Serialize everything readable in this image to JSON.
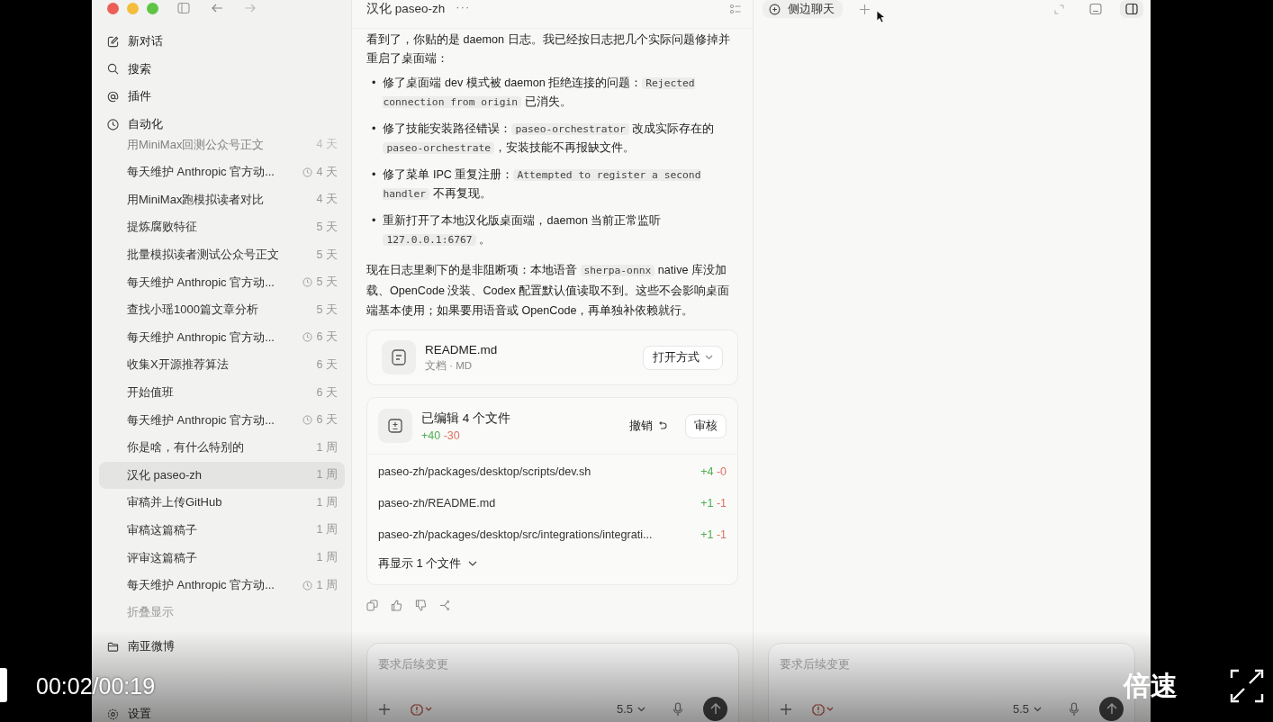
{
  "sidebar": {
    "nav": [
      {
        "label": "新对话"
      },
      {
        "label": "搜索"
      },
      {
        "label": "插件"
      },
      {
        "label": "自动化"
      }
    ],
    "conversations": [
      {
        "title": "用MiniMax回测公众号正文",
        "time": "4 天",
        "scheduled": false,
        "selected": false,
        "faded": true
      },
      {
        "title": "每天维护 Anthropic 官方动...",
        "time": "4 天",
        "scheduled": true,
        "selected": false,
        "faded": false
      },
      {
        "title": "用MiniMax跑模拟读者对比",
        "time": "4 天",
        "scheduled": false,
        "selected": false,
        "faded": false
      },
      {
        "title": "提炼腐败特征",
        "time": "5 天",
        "scheduled": false,
        "selected": false,
        "faded": false
      },
      {
        "title": "批量模拟读者测试公众号正文",
        "time": "5 天",
        "scheduled": false,
        "selected": false,
        "faded": false
      },
      {
        "title": "每天维护 Anthropic 官方动...",
        "time": "5 天",
        "scheduled": true,
        "selected": false,
        "faded": false
      },
      {
        "title": "查找小瑶1000篇文章分析",
        "time": "5 天",
        "scheduled": false,
        "selected": false,
        "faded": false
      },
      {
        "title": "每天维护 Anthropic 官方动...",
        "time": "6 天",
        "scheduled": true,
        "selected": false,
        "faded": false
      },
      {
        "title": "收集X开源推荐算法",
        "time": "6 天",
        "scheduled": false,
        "selected": false,
        "faded": false
      },
      {
        "title": "开始值班",
        "time": "6 天",
        "scheduled": false,
        "selected": false,
        "faded": false
      },
      {
        "title": "每天维护 Anthropic 官方动...",
        "time": "6 天",
        "scheduled": true,
        "selected": false,
        "faded": false
      },
      {
        "title": "你是啥，有什么特别的",
        "time": "1 周",
        "scheduled": false,
        "selected": false,
        "faded": false
      },
      {
        "title": "汉化 paseo-zh",
        "time": "1 周",
        "scheduled": false,
        "selected": true,
        "faded": false
      },
      {
        "title": "审稿并上传GitHub",
        "time": "1 周",
        "scheduled": false,
        "selected": false,
        "faded": false
      },
      {
        "title": "审稿这篇稿子",
        "time": "1 周",
        "scheduled": false,
        "selected": false,
        "faded": false
      },
      {
        "title": "评审这篇稿子",
        "time": "1 周",
        "scheduled": false,
        "selected": false,
        "faded": false
      },
      {
        "title": "每天维护 Anthropic 官方动...",
        "time": "1 周",
        "scheduled": true,
        "selected": false,
        "faded": false
      }
    ],
    "collapse_label": "折叠显示",
    "project": "南亚微博",
    "settings": "设置"
  },
  "chat": {
    "title": "汉化 paseo-zh",
    "more": "···",
    "message": {
      "intro": [
        {
          "kind": "text",
          "t": "看到了，你贴的是 daemon 日志。我已经按日志把几个实际问题修掉并重启了桌面端："
        }
      ],
      "bullet_marker": "•",
      "bullets": [
        [
          {
            "kind": "text",
            "t": "修了桌面端 dev 模式被 daemon 拒绝连接的问题："
          },
          {
            "kind": "code",
            "t": "Rejected connection from origin"
          },
          {
            "kind": "text",
            "t": " 已消失。"
          }
        ],
        [
          {
            "kind": "text",
            "t": "修了技能安装路径错误："
          },
          {
            "kind": "code",
            "t": "paseo-orchestrator"
          },
          {
            "kind": "text",
            "t": " 改成实际存在的 "
          },
          {
            "kind": "code",
            "t": "paseo-orchestrate"
          },
          {
            "kind": "text",
            "t": "，安装技能不再报缺文件。"
          }
        ],
        [
          {
            "kind": "text",
            "t": "修了菜单 IPC 重复注册："
          },
          {
            "kind": "code",
            "t": "Attempted to register a second handler"
          },
          {
            "kind": "text",
            "t": " 不再复现。"
          }
        ],
        [
          {
            "kind": "text",
            "t": "重新打开了本地汉化版桌面端，daemon 当前正常监听 "
          },
          {
            "kind": "code",
            "t": "127.0.0.1:6767"
          },
          {
            "kind": "text",
            "t": " 。"
          }
        ]
      ],
      "outro": [
        {
          "kind": "text",
          "t": "现在日志里剩下的是非阻断项：本地语音 "
        },
        {
          "kind": "code",
          "t": "sherpa-onnx"
        },
        {
          "kind": "text",
          "t": " native 库没加载、OpenCode 没装、Codex 配置默认值读取不到。这些不会影响桌面端基本使用；如果要用语音或 OpenCode，再单独补依赖就行。"
        }
      ]
    },
    "attachment": {
      "name": "README.md",
      "meta": "文档 · MD",
      "open_with": "打开方式"
    },
    "changes": {
      "title": "已编辑 4 个文件",
      "added": "+40",
      "removed": "-30",
      "undo": "撤销",
      "review": "审核",
      "files": [
        {
          "path": "paseo-zh/packages/desktop/scripts/dev.sh",
          "added": "+4",
          "removed": "-0"
        },
        {
          "path": "paseo-zh/README.md",
          "added": "+1",
          "removed": "-1"
        },
        {
          "path": "paseo-zh/packages/desktop/src/integrations/integrati...",
          "added": "+1",
          "removed": "-1"
        }
      ],
      "more": "再显示 1 个文件"
    },
    "composer": {
      "placeholder": "要求后续变更",
      "model": "5.5"
    }
  },
  "side_chat": {
    "tab": "侧边聊天",
    "composer": {
      "placeholder": "要求后续变更",
      "model": "5.5"
    }
  },
  "player": {
    "time": "00:02/00:19",
    "speed": "倍速"
  }
}
